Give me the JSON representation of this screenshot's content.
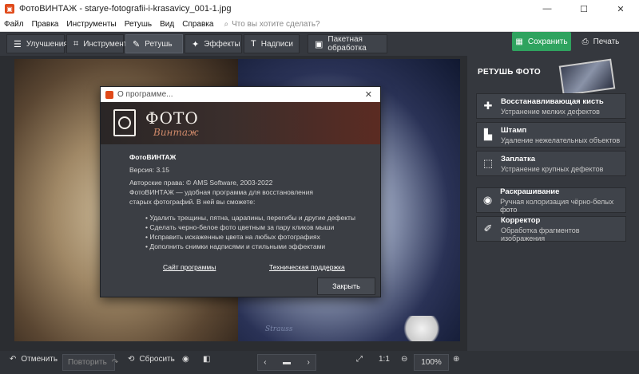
{
  "window": {
    "title": "ФотоВИНТАЖ - starye-fotografii-i-krasavicy_001-1.jpg",
    "minimize": "—",
    "maximize": "☐",
    "close": "✕"
  },
  "menu": {
    "items": [
      "Файл",
      "Правка",
      "Инструменты",
      "Ретушь",
      "Вид",
      "Справка"
    ],
    "search_placeholder": "Что вы хотите сделать?"
  },
  "toolbar": {
    "tabs": [
      {
        "label": "Улучшения",
        "icon": "sliders-icon"
      },
      {
        "label": "Инструменты",
        "icon": "crop-icon"
      },
      {
        "label": "Ретушь",
        "icon": "brush-icon"
      },
      {
        "label": "Эффекты",
        "icon": "sparkle-icon"
      },
      {
        "label": "Надписи",
        "icon": "text-icon"
      },
      {
        "label": "Пакетная обработка",
        "icon": "batch-icon"
      }
    ],
    "active_tab": "Ретушь",
    "save_label": "Сохранить",
    "print_label": "Печать"
  },
  "right_panel": {
    "header": "РЕТУШЬ ФОТО",
    "tools": [
      {
        "title": "Восстанавливающая кисть",
        "subtitle": "Устранение мелких дефектов",
        "icon": "healing-brush-icon"
      },
      {
        "title": "Штамп",
        "subtitle": "Удаление нежелательных объектов",
        "icon": "stamp-icon"
      },
      {
        "title": "Заплатка",
        "subtitle": "Устранение крупных дефектов",
        "icon": "patch-icon"
      },
      {
        "title": "Раскрашивание",
        "subtitle": "Ручная колоризация чёрно-белых фото",
        "icon": "palette-icon"
      },
      {
        "title": "Корректор",
        "subtitle": "Обработка фрагментов изображения",
        "icon": "corrector-icon"
      }
    ]
  },
  "bottom": {
    "undo": "Отменить",
    "redo": "Повторить",
    "reset": "Сбросить",
    "ratio": "1:1",
    "zoom": "100%"
  },
  "dialog": {
    "title": "О программе...",
    "logo_line1": "ФОТО",
    "logo_line2": "Винтаж",
    "app_name": "ФотоВИНТАЖ",
    "version": "Версия: 3.15",
    "copyright": "Авторские права: © AMS Software, 2003-2022",
    "description": "ФотоВИНТАЖ — удобная программа для восстановления старых фотографий. В ней вы сможете:",
    "features": [
      "• Удалить трещины, пятна, царапины, перегибы и другие дефекты",
      "• Сделать черно-белое фото цветным за пару кликов мыши",
      "• Исправить искаженные цвета на любых фотографиях",
      "• Дополнить снимки надписями и стильными эффектами"
    ],
    "link_site": "Сайт программы",
    "link_support": "Техническая поддержка",
    "close_label": "Закрыть"
  },
  "photo": {
    "signature": "Strauss"
  },
  "colors": {
    "accent_green": "#2fa35f",
    "dark_bg": "#2b2d31",
    "panel_bg": "#35383e"
  }
}
